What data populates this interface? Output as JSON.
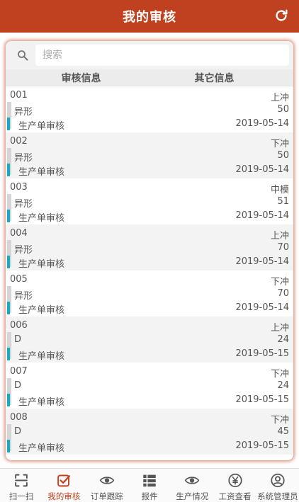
{
  "header": {
    "title": "我的审核"
  },
  "search": {
    "placeholder": "搜索"
  },
  "columns": {
    "left": "审核信息",
    "right": "其它信息"
  },
  "rows": [
    {
      "id": "001",
      "type": "异形",
      "audit": "生产单审核",
      "process": "上冲",
      "qty": "50",
      "date": "2019-05-14"
    },
    {
      "id": "002",
      "type": "异形",
      "audit": "生产单审核",
      "process": "下冲",
      "qty": "50",
      "date": "2019-05-14"
    },
    {
      "id": "003",
      "type": "异形",
      "audit": "生产单审核",
      "process": "中模",
      "qty": "51",
      "date": "2019-05-14"
    },
    {
      "id": "004",
      "type": "异形",
      "audit": "生产单审核",
      "process": "上冲",
      "qty": "70",
      "date": "2019-05-14"
    },
    {
      "id": "005",
      "type": "异形",
      "audit": "生产单审核",
      "process": "下冲",
      "qty": "70",
      "date": "2019-05-14"
    },
    {
      "id": "006",
      "type": "D",
      "audit": "生产单审核",
      "process": "上冲",
      "qty": "24",
      "date": "2019-05-15"
    },
    {
      "id": "007",
      "type": "D",
      "audit": "生产单审核",
      "process": "下冲",
      "qty": "24",
      "date": "2019-05-15"
    },
    {
      "id": "008",
      "type": "D",
      "audit": "生产单审核",
      "process": "下冲",
      "qty": "45",
      "date": "2019-05-15"
    }
  ],
  "tabbar": {
    "items": [
      {
        "label": "扫一扫",
        "icon": "scan-icon"
      },
      {
        "label": "我的审核",
        "icon": "check-square-icon",
        "active": true
      },
      {
        "label": "订单跟踪",
        "icon": "eye-icon"
      },
      {
        "label": "报件",
        "icon": "list-icon"
      },
      {
        "label": "生产情况",
        "icon": "eye-icon"
      },
      {
        "label": "工资查看",
        "icon": "yen-icon"
      },
      {
        "label": "系统管理员",
        "icon": "user-circle-icon"
      }
    ]
  },
  "colors": {
    "brand": "#c0411f",
    "accent_bar": "#19aac3",
    "active_tab": "#c0411f"
  }
}
